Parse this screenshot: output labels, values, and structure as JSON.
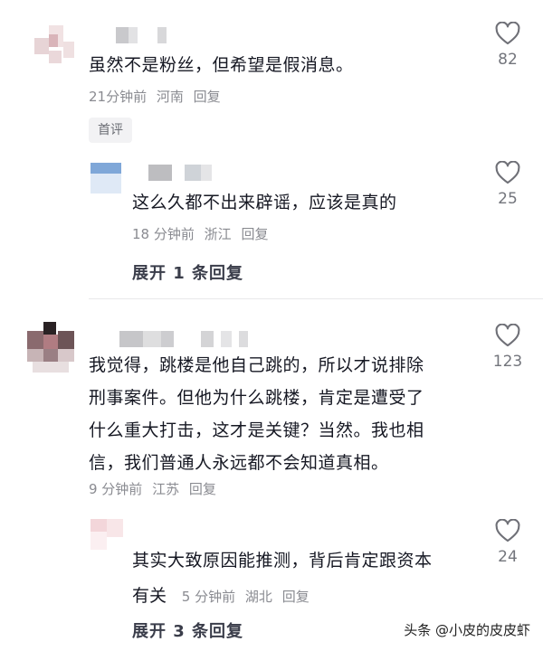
{
  "comments": [
    {
      "text": "虽然不是粉丝，但希望是假消息。",
      "time": "21分钟前",
      "location": "河南",
      "reply": "回复",
      "likes": "82",
      "badge": "首评"
    },
    {
      "text": "这么久都不出来辟谣，应该是真的",
      "time": "18 分钟前",
      "location": "浙江",
      "reply": "回复",
      "likes": "25",
      "expand": "展开 1 条回复"
    },
    {
      "text_lines": [
        "我觉得，跳楼是他自己跳的，所以才说排除",
        "刑事案件。但他为什么跳楼，肯定是遭受了",
        "什么重大打击，这才是关键？当然。我也相",
        "信，我们普通人永远都不会知道真相。"
      ],
      "time": "9 分钟前",
      "location": "江苏",
      "reply": "回复",
      "likes": "123"
    },
    {
      "text_line1": "其实大致原因能推测，背后肯定跟资本",
      "text_line2": "有关",
      "time": "5 分钟前",
      "location": "湖北",
      "reply": "回复",
      "likes": "24",
      "expand": "展开 3 条回复"
    }
  ],
  "icons": {
    "like": "heart-outline-icon"
  },
  "watermark": "头条 @小皮的皮皮虾",
  "colors": {
    "text": "#161823",
    "meta": "#8a8b91",
    "heart": "#6f7077"
  }
}
